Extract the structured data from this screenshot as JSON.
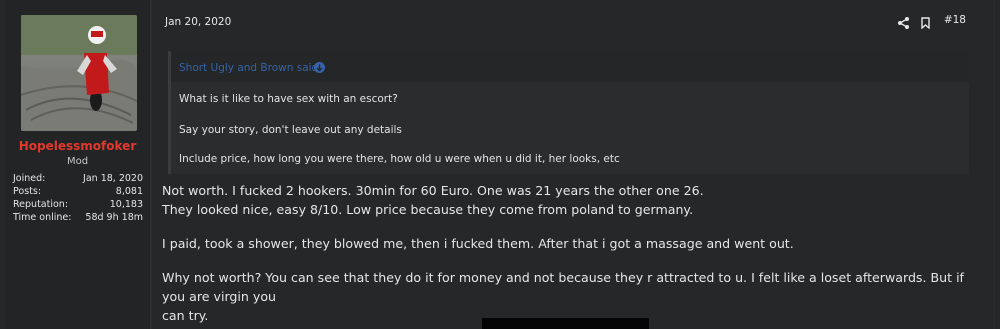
{
  "user": {
    "username": "Hopelessmofoker",
    "title": "Mod",
    "stats": [
      {
        "label": "Joined:",
        "value": "Jan 18, 2020"
      },
      {
        "label": "Posts:",
        "value": "8,081"
      },
      {
        "label": "Reputation:",
        "value": "10,183"
      },
      {
        "label": "Time online:",
        "value": "58d 9h 18m"
      }
    ]
  },
  "post": {
    "date": "Jan 20, 2020",
    "number": "#18",
    "quote": {
      "author": "Short Ugly and Brown said:",
      "lines": [
        "What is it like to have sex with an escort?",
        "Say your story, don't leave out any details",
        "Include price, how long you were there, how old u were when u did it, her looks, etc"
      ]
    },
    "body": [
      "Not worth. I fucked 2 hookers. 30min for 60 Euro. One was 21 years the other one 26.",
      "They looked nice, easy 8/10. Low price because they come from poland to germany.",
      "I paid, took a shower, they blowed me, then i fucked them. After that i got a massage and went out.",
      "Why not worth? You can see that they do it for money and not because they r attracted to u. I felt like a loset afterwards. But if you are virgin you",
      "can try."
    ]
  },
  "colors": {
    "username": "#e2392d",
    "quote_author": "#3564a8"
  },
  "icons": [
    "share-icon",
    "bookmark-icon",
    "quote-arrow-icon"
  ]
}
